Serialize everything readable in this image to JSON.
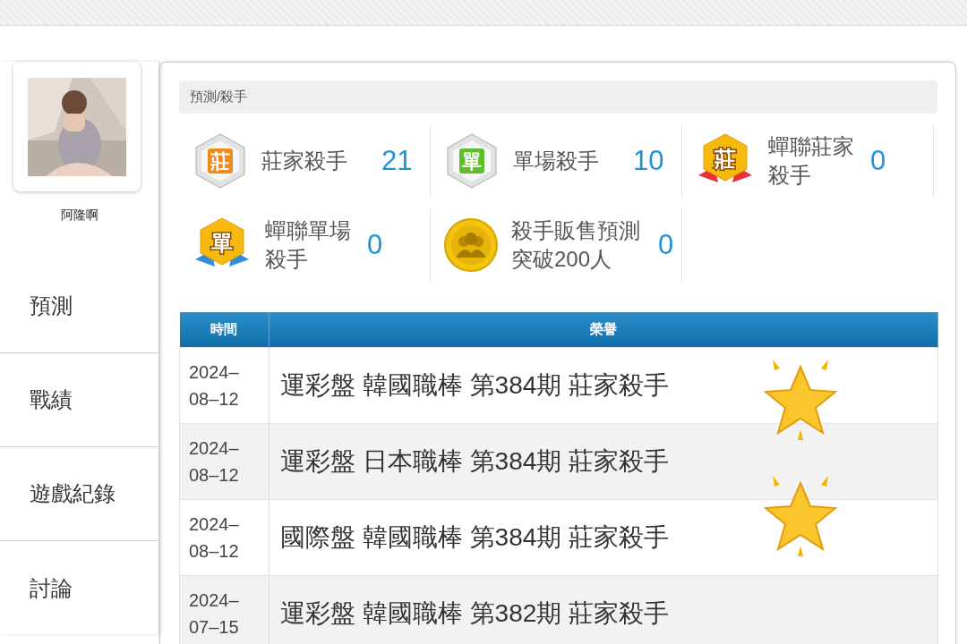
{
  "profile": {
    "name": "阿隆啊"
  },
  "menu": [
    {
      "label": "預測"
    },
    {
      "label": "戰績"
    },
    {
      "label": "遊戲紀錄"
    },
    {
      "label": "討論"
    }
  ],
  "breadcrumb": "預測/殺手",
  "achievements": [
    {
      "kind": "hex",
      "glyph": "莊",
      "color": "#f08a1c",
      "label": "莊家殺手",
      "count": "21"
    },
    {
      "kind": "hex",
      "glyph": "單",
      "color": "#5fbf2a",
      "label": "單場殺手",
      "count": "10"
    },
    {
      "kind": "ribbon",
      "glyph": "莊",
      "color": "#e8323a",
      "label": "蟬聯莊家殺手",
      "count": "0"
    },
    {
      "kind": "ribbon",
      "glyph": "單",
      "color": "#2f8fd8",
      "label": "蟬聯單場殺手",
      "count": "0"
    },
    {
      "kind": "coin",
      "label": "殺手販售預測突破200人",
      "count": "0"
    }
  ],
  "table": {
    "columns": [
      "時間",
      "榮譽"
    ],
    "rows": [
      {
        "date": "2024–08–12",
        "honor": "運彩盤 韓國職棒 第384期 莊家殺手"
      },
      {
        "date": "2024–08–12",
        "honor": "運彩盤 日本職棒 第384期 莊家殺手"
      },
      {
        "date": "2024–08–12",
        "honor": "國際盤 韓國職棒 第384期 莊家殺手"
      },
      {
        "date": "2024–07–15",
        "honor": "運彩盤 韓國職棒 第382期 莊家殺手"
      }
    ]
  }
}
